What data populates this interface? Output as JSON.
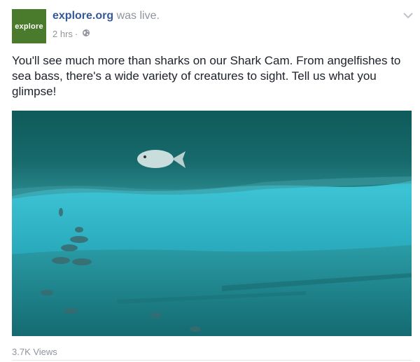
{
  "post": {
    "avatar_text": "explore",
    "page_name": "explore.org",
    "status_text": "was live.",
    "timestamp": "2 hrs",
    "separator": "·",
    "privacy_icon": "globe-icon",
    "menu_icon": "chevron-down-icon",
    "caption": "You'll see much more than sharks on our Shark Cam. From angelfishes to sea bass, there's a wide variety of creatures to sight. Tell us what you glimpse!",
    "views": "3.7K Views"
  },
  "colors": {
    "link": "#365899",
    "muted": "#90949c",
    "text": "#1d2129",
    "avatar_bg": "#4a7a2c",
    "water": "#1f9db3"
  }
}
